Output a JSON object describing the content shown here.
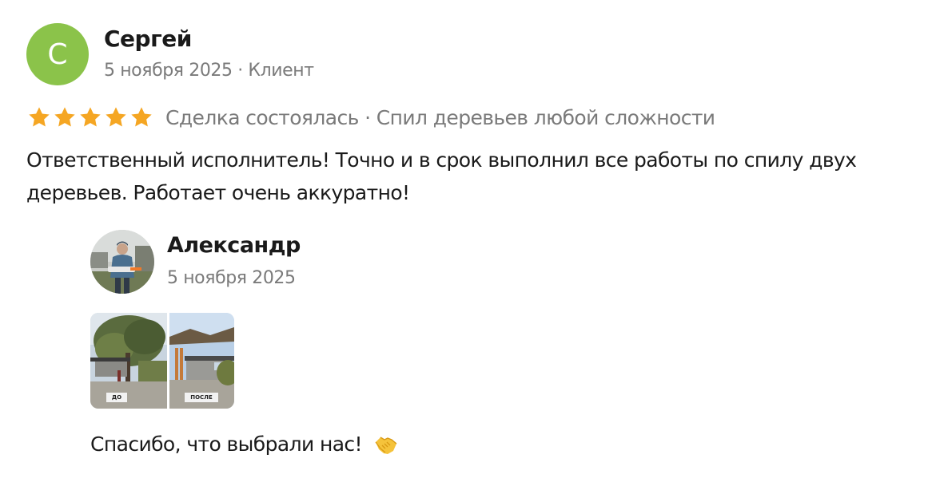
{
  "review": {
    "author": {
      "initial": "С",
      "name": "Сергей",
      "meta": "5 ноября 2025 · Клиент",
      "avatar_color": "#8bc34a"
    },
    "rating": {
      "stars": 5,
      "star_color": "#f5a623",
      "text": "Сделка состоялась · Спил деревьев любой сложности"
    },
    "body": "Ответственный исполнитель! Точно и в срок выполнил все работы по спилу двух деревьев. Работает очень аккуратно!"
  },
  "reply": {
    "author": {
      "name": "Александр",
      "date": "5 ноября 2025",
      "avatar_icon": "worker-photo"
    },
    "photo": {
      "label_before": "ДО",
      "label_after": "ПОСЛЕ"
    },
    "text": "Спасибо, что выбрали нас!",
    "emoji_icon": "handshake-icon"
  }
}
